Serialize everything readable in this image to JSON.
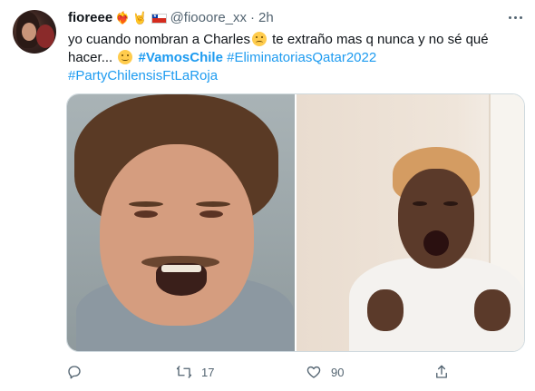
{
  "author": {
    "display_name": "fioreee",
    "emojis": [
      "❤️‍🔥",
      "🤘",
      "🇨🇱"
    ],
    "handle": "@fiooore_xx",
    "separator": "·",
    "time": "2h"
  },
  "tweet": {
    "line1_a": "yo cuando nombran a Charles",
    "line1_b": " te extraño mas q nunca y no sé qué",
    "line2_a": "hacer... ",
    "hashtag_1": "#VamosChile",
    "hashtag_2": "#EliminatoriasQatar2022",
    "hashtag_3": "#PartyChilensisFtLaRoja"
  },
  "actions": {
    "reply_count": "",
    "retweet_count": "17",
    "like_count": "90"
  },
  "icons": {
    "more": "more-dots-icon",
    "reply": "reply-icon",
    "retweet": "retweet-icon",
    "like": "heart-icon",
    "share": "share-icon"
  },
  "colors": {
    "link": "#1d9bf0",
    "secondary_text": "#536471",
    "primary_text": "#0f1419"
  }
}
